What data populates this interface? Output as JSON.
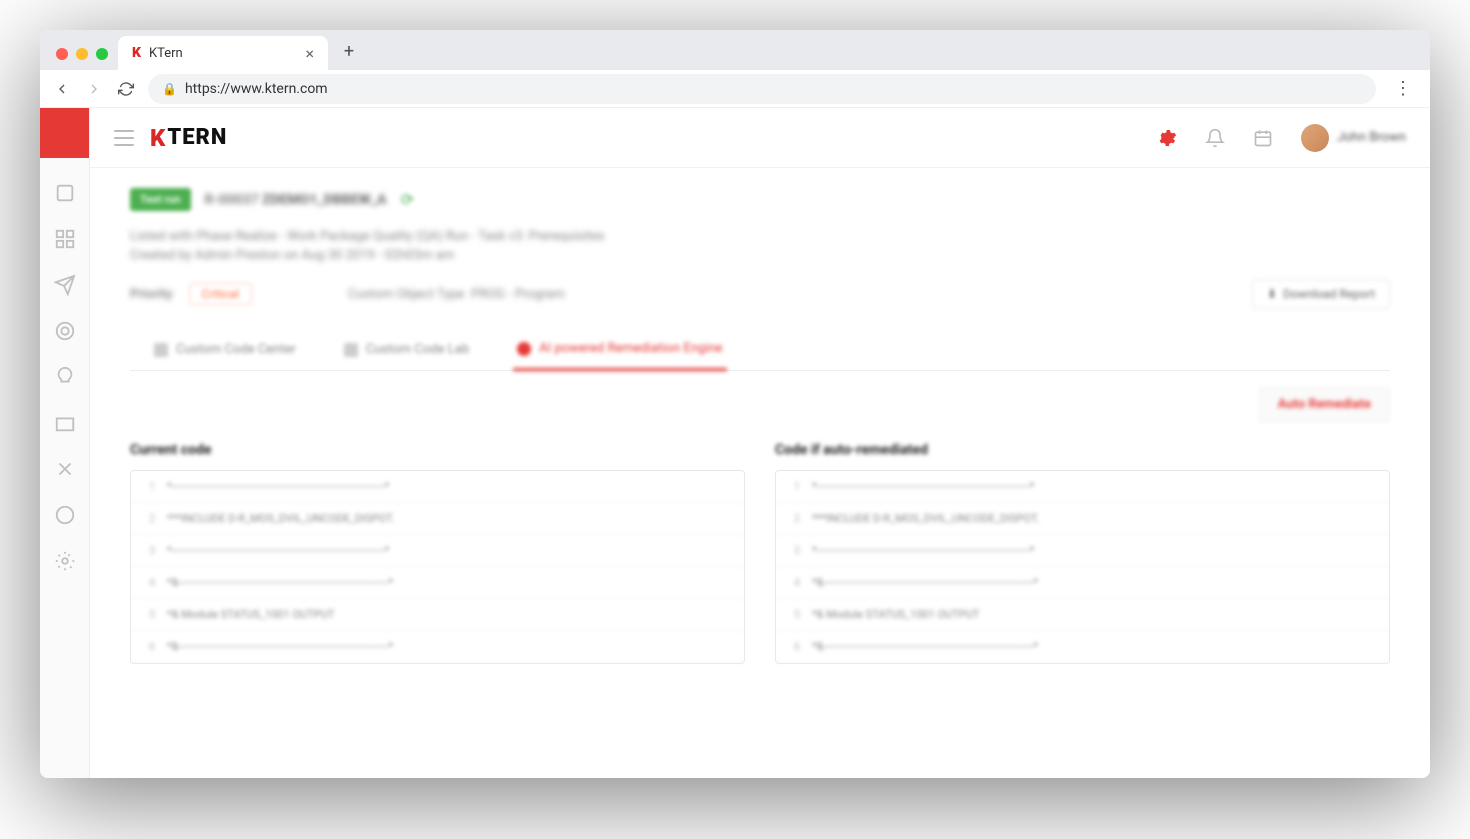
{
  "browser": {
    "tab_title": "KTern",
    "url": "https://www.ktern.com"
  },
  "logo_text": "TERN",
  "user_name": "John Brown",
  "header": {
    "pill": "Test run",
    "prefix": "R-00037",
    "id": "ZDEMO1_DBBEW_A",
    "meta1": "Listed with Phase Realize - Work Package Quality (QA) Run - Task v3: Prerequisites",
    "meta2": "Created by Admin Preston on Aug 30 2019 - 02h03m am",
    "priority_label": "Priority",
    "priority_value": "Critical",
    "obj_label": "Custom Object Type",
    "obj_value": "PROG - Program",
    "download": "Download Report"
  },
  "tabs": {
    "t1": "Custom Code Center",
    "t2": "Custom Code Lab",
    "t3": "AI powered Remediation Engine"
  },
  "auto_remediate": "Auto Remediate",
  "code": {
    "left_title": "Current code",
    "right_title": "Code if auto-remediated",
    "lines": [
      {
        "n": "1",
        "t": "*----------------------------------------------------------------------*"
      },
      {
        "n": "2",
        "t": "***INCLUDE D-R_MOS_DVIL_UNCODE_DISPOT."
      },
      {
        "n": "3",
        "t": "*----------------------------------------------------------------------*"
      },
      {
        "n": "4",
        "t": "*&---------------------------------------------------------------------*"
      },
      {
        "n": "5",
        "t": "*& Module STATUS_1001 OUTPUT"
      },
      {
        "n": "6",
        "t": "*&---------------------------------------------------------------------*"
      }
    ]
  }
}
